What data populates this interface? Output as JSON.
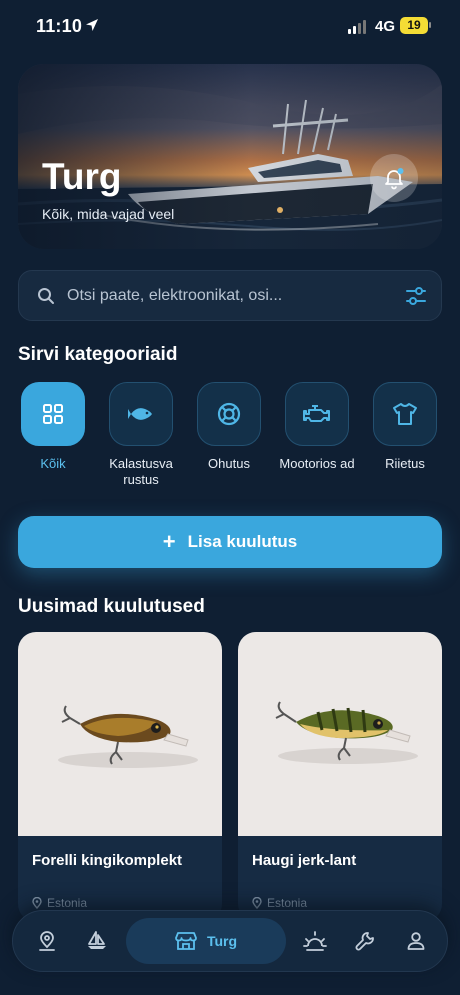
{
  "status": {
    "time": "11:10",
    "network": "4G",
    "battery": "19"
  },
  "hero": {
    "title": "Turg",
    "subtitle": "Kõik, mida vajad veel"
  },
  "search": {
    "placeholder": "Otsi paate, elektroonikat, osi..."
  },
  "categories": {
    "title": "Sirvi kategooriaid",
    "items": [
      {
        "label": "Kõik",
        "icon": "grid-icon",
        "active": true
      },
      {
        "label": "Kalastusva rustus",
        "icon": "fish-icon",
        "active": false
      },
      {
        "label": "Ohutus",
        "icon": "lifebuoy-icon",
        "active": false
      },
      {
        "label": "Mootorios ad",
        "icon": "engine-icon",
        "active": false
      },
      {
        "label": "Riietus",
        "icon": "shirt-icon",
        "active": false
      }
    ]
  },
  "add_listing": {
    "label": "Lisa kuulutus"
  },
  "listings": {
    "title": "Uusimad kuulutused",
    "items": [
      {
        "title": "Forelli kingikomplekt",
        "location": "Estonia"
      },
      {
        "title": "Haugi jerk-lant",
        "location": "Estonia"
      }
    ]
  },
  "nav": {
    "items": [
      {
        "icon": "map-pin-icon"
      },
      {
        "icon": "sailboat-icon"
      },
      {
        "icon": "store-icon",
        "label": "Turg",
        "active": true
      },
      {
        "icon": "weather-icon"
      },
      {
        "icon": "wrench-icon"
      },
      {
        "icon": "user-icon"
      }
    ]
  },
  "colors": {
    "background": "#0f1f33",
    "accent": "#3aa7dd",
    "card": "#162b43"
  }
}
